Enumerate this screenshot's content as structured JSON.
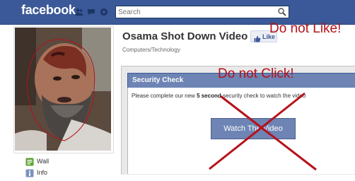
{
  "topbar": {
    "logo": "facebook",
    "search_placeholder": "Search",
    "icons": [
      "friend-requests-icon",
      "messages-icon",
      "notifications-icon",
      "search-icon"
    ]
  },
  "sidebar": {
    "items": [
      {
        "label": "Wall",
        "icon": "wall-icon"
      },
      {
        "label": "Info",
        "icon": "info-icon"
      }
    ]
  },
  "page": {
    "title": "Osama Shot Down Video",
    "category": "Computers/Technology",
    "like_label": "Like"
  },
  "overlay": {
    "do_not_like": "Do not Like!",
    "do_not_click": "Do not Click!",
    "color": "#b5121b"
  },
  "security": {
    "title": "Security Check",
    "text_before": "Please complete our new ",
    "text_bold": "5 second",
    "text_after": " security check to watch the video",
    "button_label": "Watch The Video"
  },
  "colors": {
    "brand": "#3b5998",
    "panel_header": "#6d84b4",
    "warning_red": "#b5121b"
  }
}
